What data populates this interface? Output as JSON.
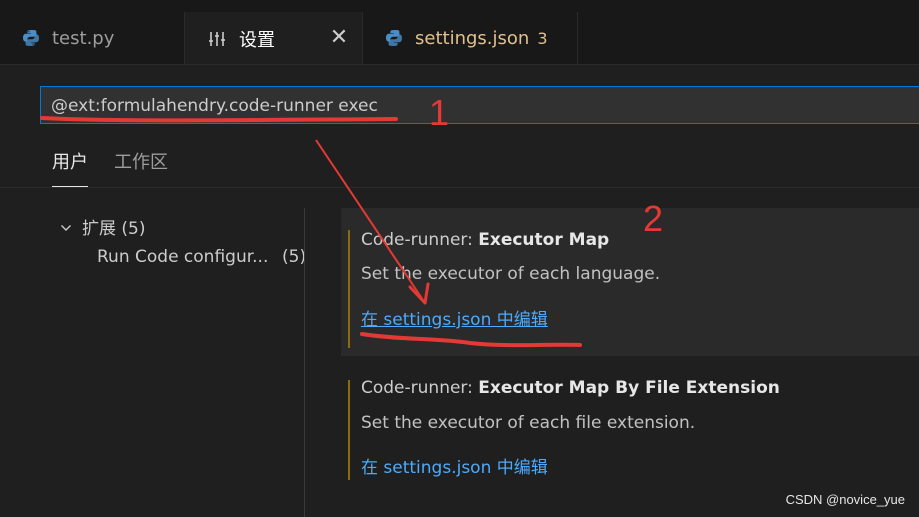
{
  "tabs": [
    {
      "label": "test.py",
      "icon": "python-icon"
    },
    {
      "label": "设置",
      "icon": "settings-sliders-icon",
      "close": "✕"
    },
    {
      "label": "settings.json",
      "badge": "3",
      "icon": "python-icon"
    }
  ],
  "search": {
    "value": "@ext:formulahendry.code-runner exec"
  },
  "scope_tabs": [
    "用户",
    "工作区"
  ],
  "tree": {
    "group_label": "扩展",
    "group_count": "(5)",
    "child_label": "Run Code configur...",
    "child_count": "(5)"
  },
  "items": [
    {
      "category": "Code-runner: ",
      "name": "Executor Map",
      "description": "Set the executor of each language.",
      "link": "在 settings.json 中编辑"
    },
    {
      "category": "Code-runner: ",
      "name": "Executor Map By File Extension",
      "description": "Set the executor of each file extension.",
      "link": "在 settings.json 中编辑"
    }
  ],
  "annotations": {
    "one": "1",
    "two": "2",
    "color": "#e53935"
  },
  "watermark": "CSDN @novice_yue",
  "colors": {
    "accent": "#0078d4",
    "link": "#4daafc",
    "modified_bar": "#8a6b10",
    "tab_yellow": "#e2c08d"
  }
}
